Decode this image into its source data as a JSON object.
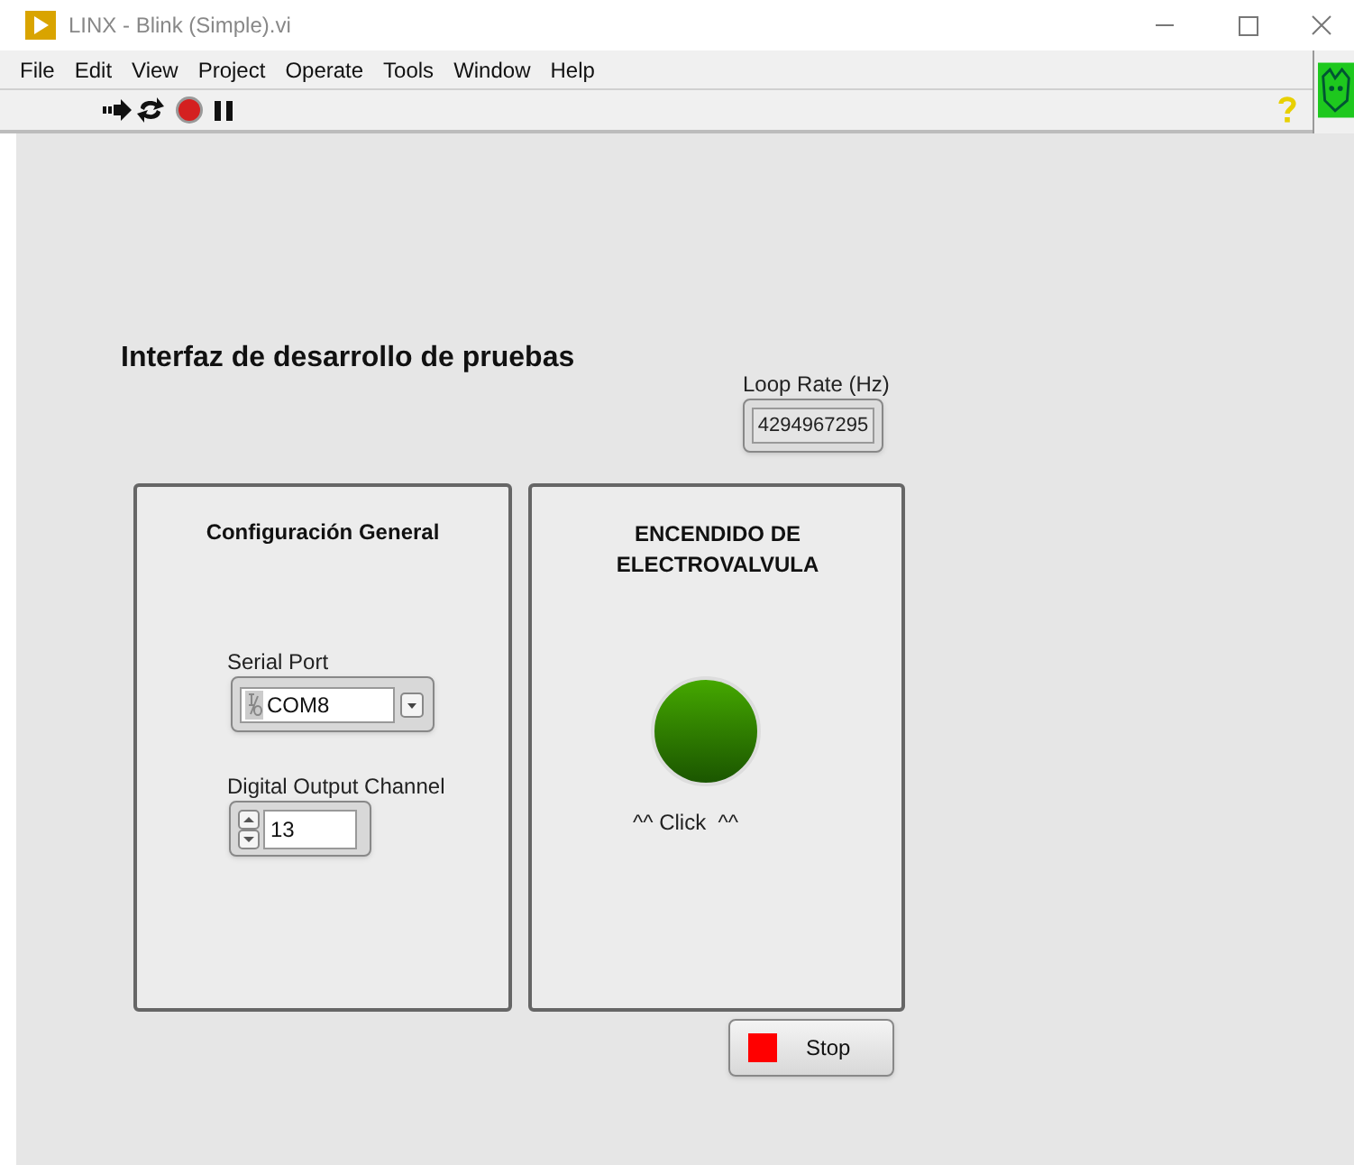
{
  "window": {
    "title": "LINX - Blink (Simple).vi"
  },
  "menu": [
    "File",
    "Edit",
    "View",
    "Project",
    "Operate",
    "Tools",
    "Window",
    "Help"
  ],
  "heading": "Interfaz de desarrollo de pruebas",
  "loop_rate": {
    "label": "Loop Rate (Hz)",
    "value": "4294967295"
  },
  "config_panel": {
    "title": "Configuración General",
    "serial_port": {
      "label": "Serial Port",
      "value": "COM8"
    },
    "channel": {
      "label": "Digital Output Channel",
      "value": "13"
    }
  },
  "valve_panel": {
    "title": "ENCENDIDO DE ELECTROVALVULA",
    "led": {
      "on": false
    },
    "caption": "^^ Click  ^^"
  },
  "stop_button": {
    "label": "Stop"
  }
}
